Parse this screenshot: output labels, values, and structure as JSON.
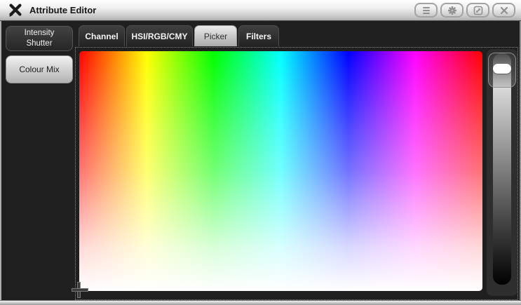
{
  "titlebar": {
    "title": "Attribute Editor",
    "buttons": [
      {
        "name": "menu",
        "icon": "hamburger-icon"
      },
      {
        "name": "settings",
        "icon": "gear-icon"
      },
      {
        "name": "resize",
        "icon": "resize-diagonal-icon"
      },
      {
        "name": "close",
        "icon": "close-icon"
      }
    ]
  },
  "sidebar": {
    "buttons": [
      {
        "label": "Intensity Shutter",
        "selected": false
      },
      {
        "label": "Colour Mix",
        "selected": true
      }
    ]
  },
  "tabs": {
    "items": [
      {
        "label": "Channel",
        "selected": false
      },
      {
        "label": "HSI/RGB/CMY",
        "selected": false
      },
      {
        "label": "Picker",
        "selected": true
      },
      {
        "label": "Filters",
        "selected": false
      }
    ]
  },
  "picker": {
    "hue_stops": [
      "#ff0000",
      "#ffff00",
      "#00ff00",
      "#00ffff",
      "#0000ff",
      "#ff00ff",
      "#ff0000"
    ],
    "fade_to": "#ffffff",
    "cursor": {
      "position": "bottom-left"
    },
    "value_slider": {
      "orientation": "vertical",
      "top_color": "#ffffff",
      "bottom_color": "#000000",
      "thumb_position": "top"
    }
  },
  "colors": {
    "titlebar_top": "#ffffff",
    "titlebar_bottom": "#aeaeae",
    "window_bg": "#1f1f1f",
    "dark_button_top": "#424242",
    "dark_button_bottom": "#262626",
    "selected_button_top": "#f2f2f2",
    "selected_button_bottom": "#b2b2b2"
  }
}
